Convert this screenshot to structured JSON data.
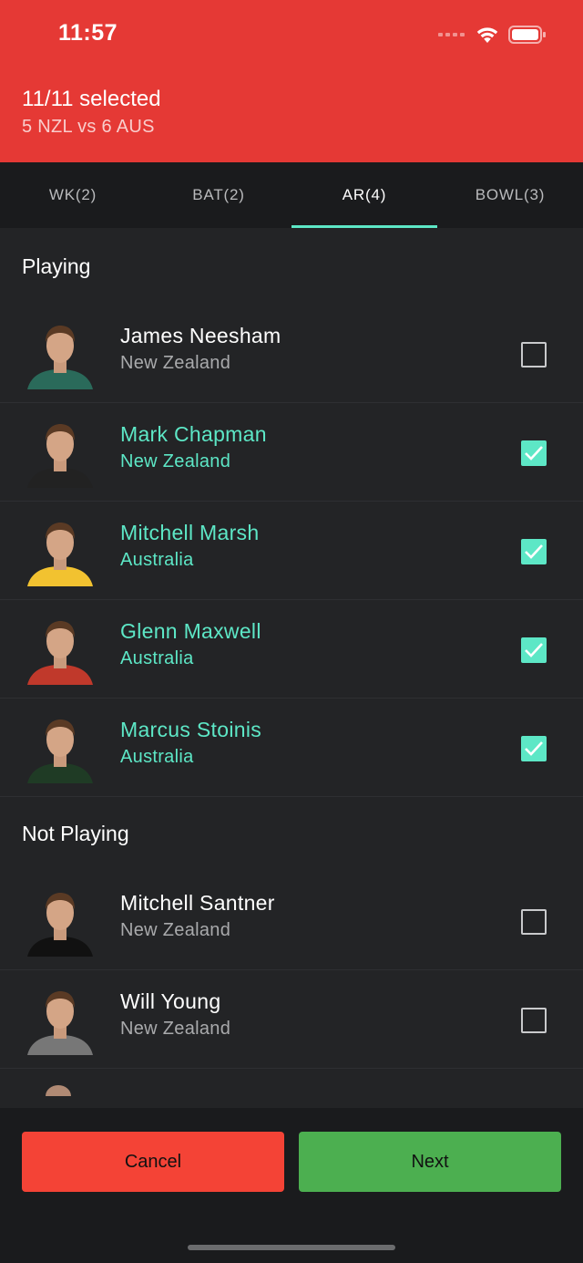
{
  "status_bar": {
    "time": "11:57"
  },
  "header": {
    "title": "11/11 selected",
    "subtitle": "5 NZL vs 6 AUS",
    "color": "#e53935"
  },
  "tabs": [
    {
      "label": "WK(2)",
      "active": false
    },
    {
      "label": "BAT(2)",
      "active": false
    },
    {
      "label": "AR(4)",
      "active": true
    },
    {
      "label": "BOWL(3)",
      "active": false
    }
  ],
  "sections": {
    "playing": {
      "title": "Playing",
      "players": [
        {
          "name": "James Neesham",
          "team": "New Zealand",
          "selected": false,
          "kit": "#2a6a5a"
        },
        {
          "name": "Mark Chapman",
          "team": "New Zealand",
          "selected": true,
          "kit": "#222222"
        },
        {
          "name": "Mitchell Marsh",
          "team": "Australia",
          "selected": true,
          "kit": "#f2c230"
        },
        {
          "name": "Glenn Maxwell",
          "team": "Australia",
          "selected": true,
          "kit": "#c0392b"
        },
        {
          "name": "Marcus Stoinis",
          "team": "Australia",
          "selected": true,
          "kit": "#1f3b25"
        }
      ]
    },
    "not_playing": {
      "title": "Not Playing",
      "players": [
        {
          "name": "Mitchell Santner",
          "team": "New Zealand",
          "selected": false,
          "kit": "#111111"
        },
        {
          "name": "Will Young",
          "team": "New Zealand",
          "selected": false,
          "kit": "#777777"
        }
      ]
    }
  },
  "actions": {
    "cancel_label": "Cancel",
    "next_label": "Next"
  },
  "colors": {
    "accent": "#5de7c6",
    "cancel": "#f44336",
    "next": "#4caf50"
  }
}
